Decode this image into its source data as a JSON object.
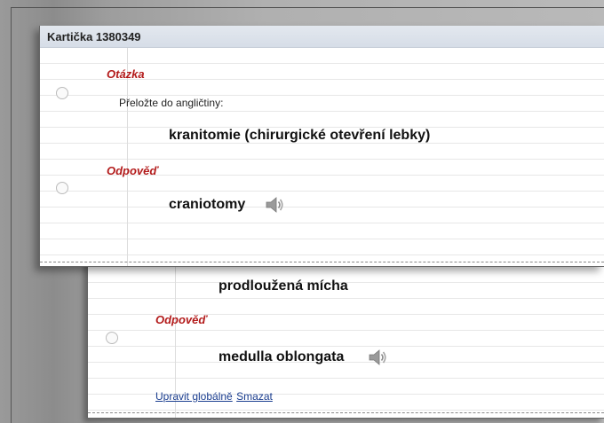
{
  "back_card": {
    "question_term": "prodloužená mícha",
    "answer_label": "Odpověď",
    "answer_term": "medulla oblongata",
    "speaker_icon": "speaker-icon",
    "actions": {
      "edit_global": "Upravit globálně",
      "delete": "Smazat"
    }
  },
  "front_card": {
    "title": "Kartička 1380349",
    "question_label": "Otázka",
    "instruction": "Přeložte do angličtiny:",
    "question_term": "kranitomie (chirurgické otevření lebky)",
    "answer_label": "Odpověď",
    "answer_term": "craniotomy",
    "speaker_icon": "speaker-icon"
  },
  "colors": {
    "label_red": "#b31b1b",
    "header_bg": "#dde3eb",
    "link_blue": "#1a3d8f"
  }
}
